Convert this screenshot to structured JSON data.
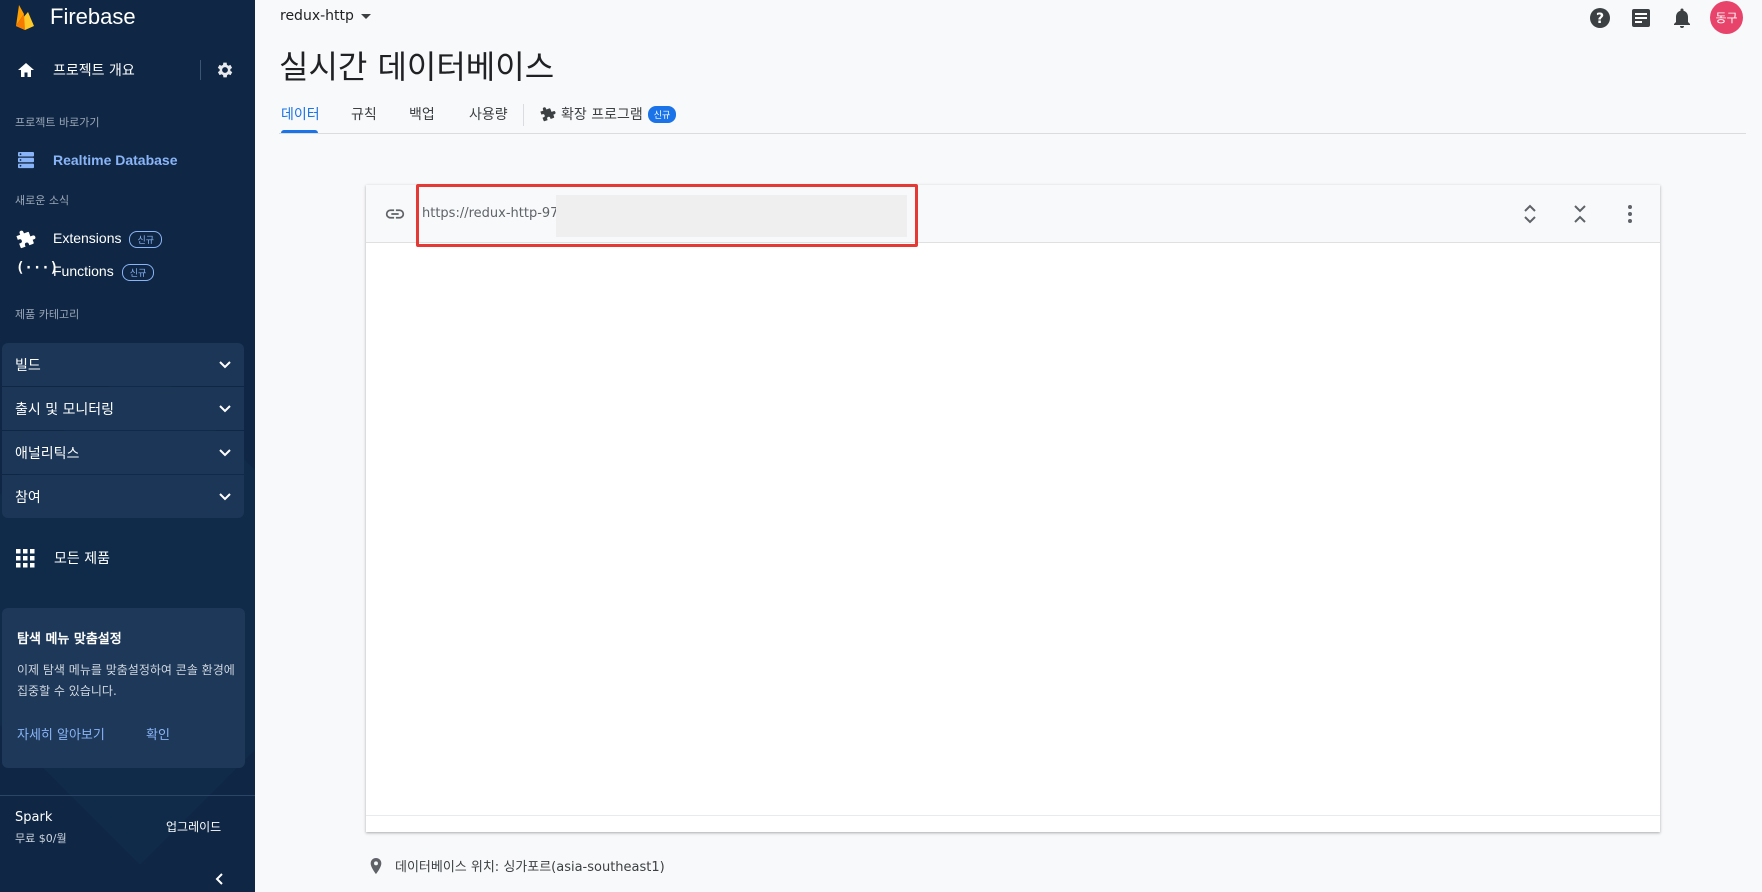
{
  "sidebar": {
    "brand": "Firebase",
    "overview_label": "프로젝트 개요",
    "shortcuts_label": "프로젝트 바로가기",
    "realtime_db_label": "Realtime Database",
    "news_label": "새로운 소식",
    "extensions_label": "Extensions",
    "extensions_badge": "신규",
    "functions_label": "Functions",
    "functions_badge": "신규",
    "product_category_label": "제품 카테고리",
    "categories": [
      "빌드",
      "출시 및 모니터링",
      "애널리틱스",
      "참여"
    ],
    "all_products_label": "모든 제품",
    "card": {
      "title": "탐색 메뉴 맞춤설정",
      "body": "이제 탐색 메뉴를 맞춤설정하여 콘솔 환경에 집중할 수 있습니다.",
      "learn_more": "자세히 알아보기",
      "confirm": "확인"
    },
    "plan_name": "Spark",
    "plan_price": "무료 $0/월",
    "upgrade_label": "업그레이드"
  },
  "header": {
    "project_name": "redux-http",
    "avatar_text": "동구"
  },
  "main": {
    "title": "실시간 데이터베이스",
    "tabs": [
      "데이터",
      "규칙",
      "백업",
      "사용량"
    ],
    "active_tab": "데이터",
    "extensions_tab": "확장 프로그램",
    "extensions_badge": "신규"
  },
  "db": {
    "url": "https://redux-http-97("
  },
  "location_text": "데이터베이스 위치: 싱가포르(asia-southeast1)"
}
